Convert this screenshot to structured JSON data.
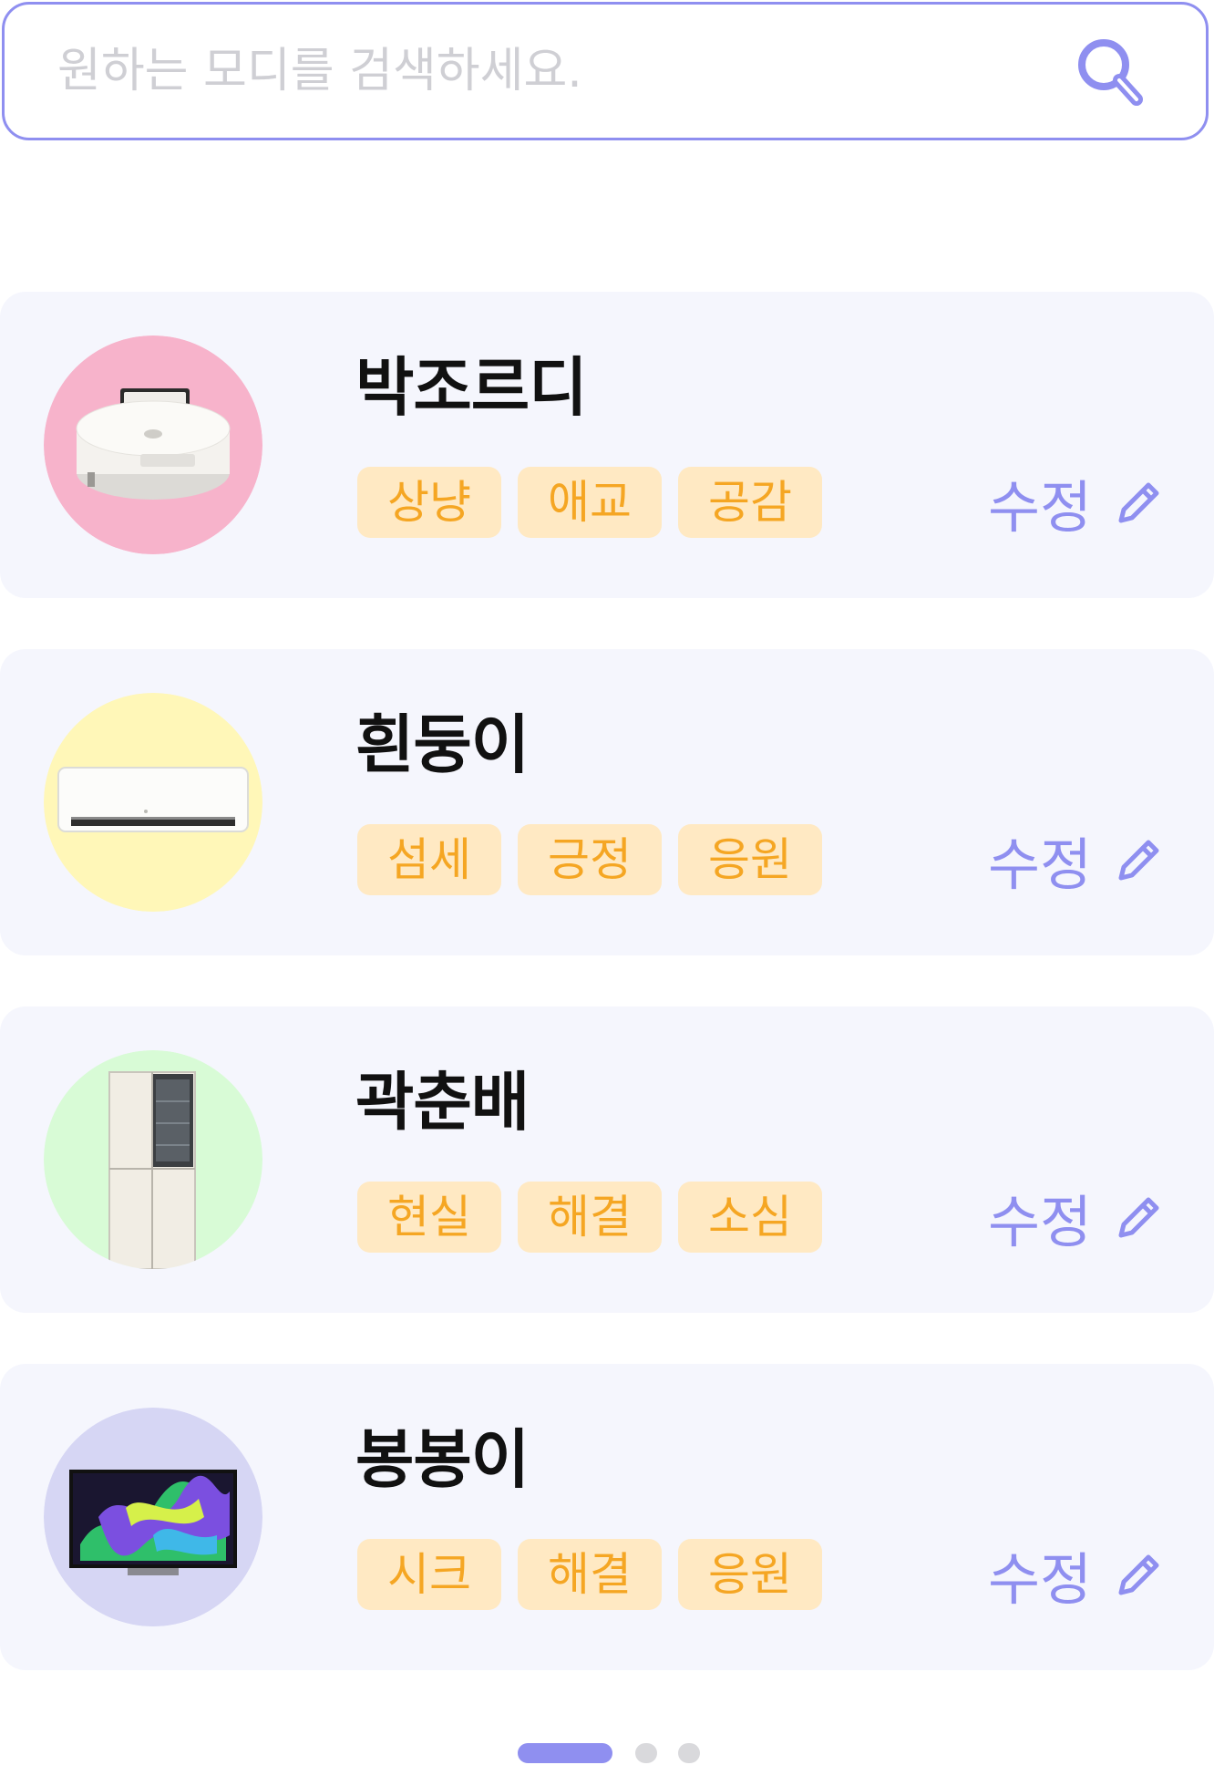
{
  "search": {
    "placeholder": "원하는 모디를 검색하세요.",
    "value": "",
    "icon": "search-icon"
  },
  "colors": {
    "accent": "#8f8ff0",
    "tag_bg": "#ffe9c3",
    "tag_text": "#f5a623",
    "card_bg": "#f5f6fd"
  },
  "cards": [
    {
      "name": "박조르디",
      "tags": [
        "상냥",
        "애교",
        "공감"
      ],
      "edit_label": "수정",
      "avatar_bg": "#f7b3cb",
      "product": "robot-vacuum"
    },
    {
      "name": "흰둥이",
      "tags": [
        "섬세",
        "긍정",
        "응원"
      ],
      "edit_label": "수정",
      "avatar_bg": "#fff7b8",
      "product": "air-conditioner"
    },
    {
      "name": "곽춘배",
      "tags": [
        "현실",
        "해결",
        "소심"
      ],
      "edit_label": "수정",
      "avatar_bg": "#d8fbd6",
      "product": "refrigerator"
    },
    {
      "name": "봉봉이",
      "tags": [
        "시크",
        "해결",
        "응원"
      ],
      "edit_label": "수정",
      "avatar_bg": "#d6d6f4",
      "product": "television"
    }
  ],
  "pagination": {
    "total": 3,
    "current": 1
  }
}
